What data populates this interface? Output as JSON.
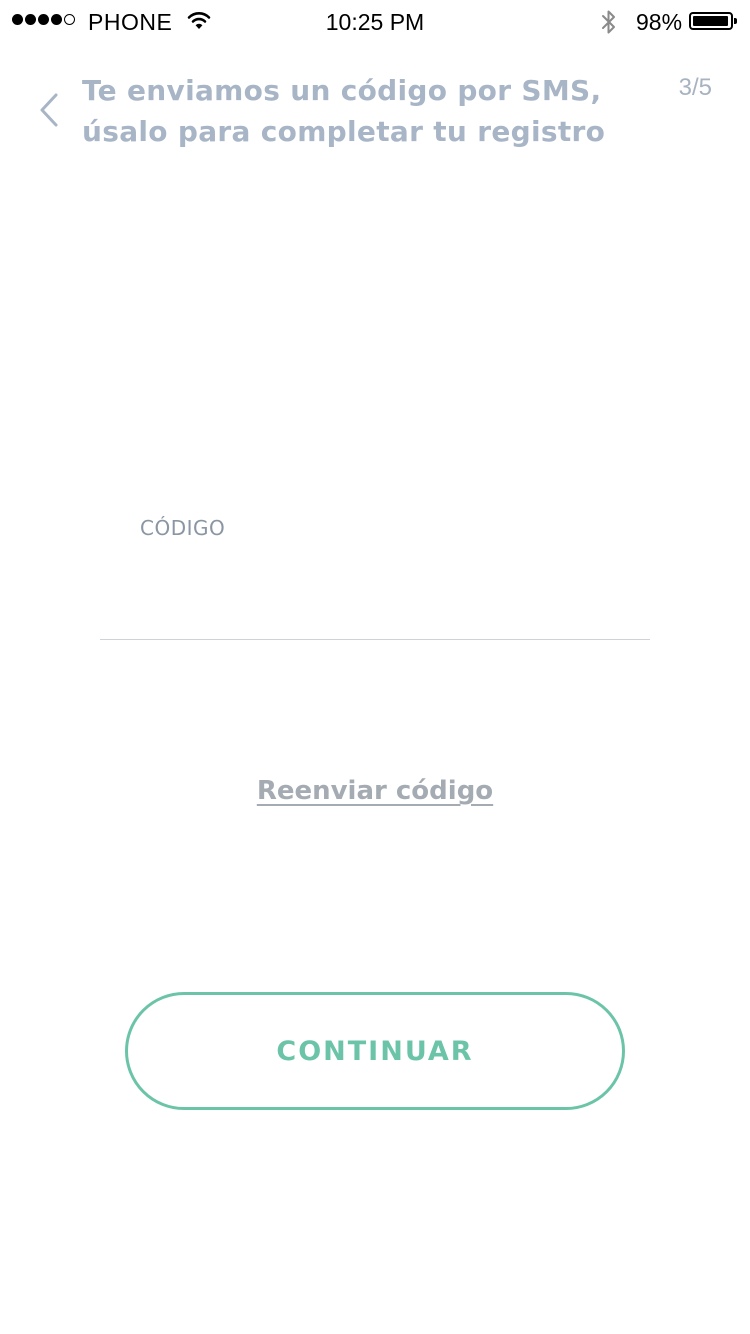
{
  "status_bar": {
    "carrier": "PHONE",
    "time": "10:25 PM",
    "battery_percent": "98%",
    "battery_level": 0.98,
    "signal_bars_filled": 4,
    "signal_bars_total": 5,
    "icons": [
      "wifi-icon",
      "bluetooth-icon",
      "battery-icon"
    ]
  },
  "header": {
    "title_line1": "Te enviamos un código por SMS,",
    "title_line2": "úsalo para completar tu registro",
    "step": "3/5",
    "back_icon": "chevron-left-icon"
  },
  "form": {
    "code_label": "CÓDIGO",
    "code_value": "",
    "code_placeholder": ""
  },
  "resend_link": "Reenviar código",
  "continue_button": "CONTINUAR",
  "colors": {
    "accent": "#6cc4a8",
    "header_text": "#a8b5c6",
    "muted_text": "#a4abb2",
    "divider": "#cfd3d8"
  }
}
